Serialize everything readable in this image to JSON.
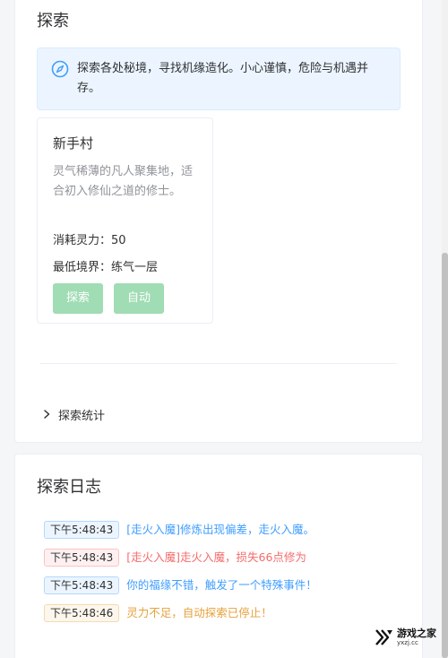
{
  "explore_panel": {
    "title": "探索",
    "notice": "探索各处秘境，寻找机缘造化。小心谨慎，危险与机遇并存。",
    "locations": [
      {
        "name": "新手村",
        "description": "灵气稀薄的凡人聚集地，适合初入修仙之道的修士。",
        "cost_label": "消耗灵力：50",
        "realm_label": "最低境界：练气一层",
        "explore_button": "探索",
        "auto_button": "自动"
      }
    ],
    "stats_label": "探索统计"
  },
  "log_panel": {
    "title": "探索日志",
    "entries": [
      {
        "time": "下午5:48:43",
        "message": "[走火入魔]修炼出现偏差，走火入魔。",
        "type": "info",
        "color": "#409eff"
      },
      {
        "time": "下午5:48:43",
        "message": "[走火入魔]走火入魔，损失66点修为",
        "type": "danger",
        "color": "#f56c6c"
      },
      {
        "time": "下午5:48:43",
        "message": "你的福缘不错，触发了一个特殊事件！",
        "type": "info",
        "color": "#409eff"
      },
      {
        "time": "下午5:48:46",
        "message": "灵力不足，自动探索已停止！",
        "type": "warning",
        "color": "#e6a23c"
      }
    ]
  },
  "watermark": {
    "main": "游戏之家",
    "sub": "yxzj.cc"
  },
  "icons": {
    "notice": "compass-icon",
    "collapse": "chevron-right-icon"
  },
  "colors": {
    "primary": "#409eff",
    "success_light": "#a0dcb4",
    "danger": "#f56c6c",
    "warning": "#e6a23c"
  }
}
